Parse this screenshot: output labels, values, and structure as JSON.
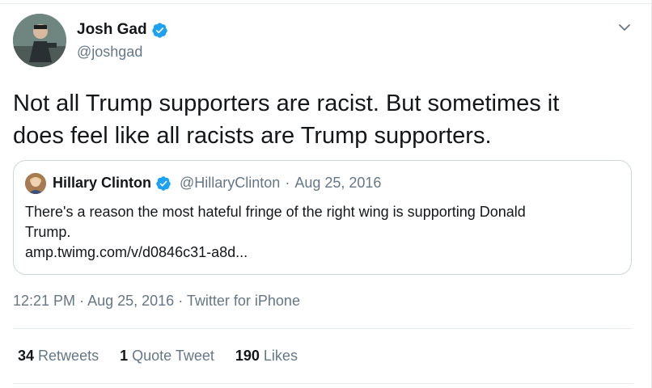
{
  "author": {
    "display_name": "Josh Gad",
    "handle": "@joshgad",
    "verified": true
  },
  "tweet": {
    "text_line1": "Not all Trump supporters are racist. But sometimes it",
    "text_line2": "does feel like all racists are Trump supporters."
  },
  "quoted": {
    "display_name": "Hillary Clinton",
    "handle": "@HillaryClinton",
    "separator": "·",
    "date": "Aug 25, 2016",
    "text_line1": "There's a reason the most hateful fringe of the right wing is supporting Donald",
    "text_line2": "Trump.",
    "link": "amp.twimg.com/v/d0846c31-a8d..."
  },
  "meta": {
    "time": "12:21 PM",
    "separator": "·",
    "date": "Aug 25, 2016",
    "source": "Twitter for iPhone"
  },
  "stats": {
    "retweets_count": "34",
    "retweets_label": "Retweets",
    "quotes_count": "1",
    "quotes_label": "Quote Tweet",
    "likes_count": "190",
    "likes_label": "Likes"
  },
  "colors": {
    "verified_blue": "#1da1f2",
    "secondary_text": "#657786",
    "border": "#e6ecf0"
  },
  "icons": {
    "verified": "verified-badge-icon",
    "caret": "chevron-down-icon"
  }
}
